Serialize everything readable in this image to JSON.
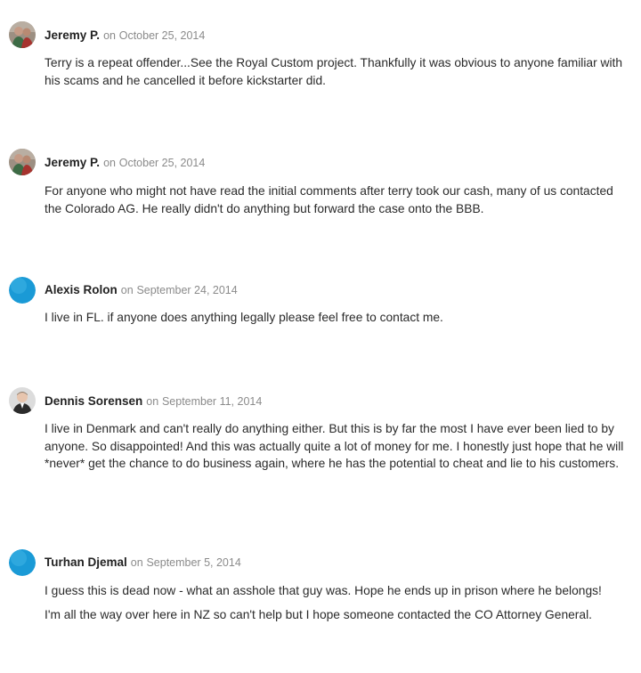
{
  "comments": [
    {
      "author": "Jeremy P.",
      "on": "on",
      "date": "October 25, 2014",
      "avatar": "photo-avatar-jeremy",
      "paragraphs": [
        "Terry is a repeat offender...See the Royal Custom project. Thankfully it was obvious to anyone familiar with his scams and he cancelled it before kickstarter did."
      ]
    },
    {
      "author": "Jeremy P.",
      "on": "on",
      "date": "October 25, 2014",
      "avatar": "photo-avatar-jeremy",
      "paragraphs": [
        "For anyone who might not have read the initial comments after terry took our cash, many of us contacted the Colorado AG. He really didn't do anything but forward the case onto the BBB."
      ]
    },
    {
      "author": "Alexis Rolon",
      "on": "on",
      "date": "September 24, 2014",
      "avatar": "default-blue-avatar",
      "paragraphs": [
        "I live in FL. if anyone does anything legally please feel free to contact me."
      ]
    },
    {
      "author": "Dennis Sorensen",
      "on": "on",
      "date": "September 11, 2014",
      "avatar": "photo-avatar-dennis",
      "paragraphs": [
        "I live in Denmark and can't really do anything either. But this is by far the most I have ever been lied to by anyone. So disappointed! And this was actually quite a lot of money for me. I honestly just hope that he will *never* get the chance to do business again, where he has the potential to cheat and lie to his customers."
      ]
    },
    {
      "author": "Turhan Djemal",
      "on": "on",
      "date": "September 5, 2014",
      "avatar": "default-blue-avatar",
      "paragraphs": [
        "I guess this is dead now - what an asshole that guy was. Hope he ends up in prison where he belongs!",
        "I'm all the way over here in NZ so can't help but I hope someone contacted the CO Attorney General."
      ]
    }
  ],
  "colors": {
    "author": "#222222",
    "meta": "#8b8b8b",
    "body": "#2a2a2a",
    "default_avatar": "#1a9ad6"
  }
}
